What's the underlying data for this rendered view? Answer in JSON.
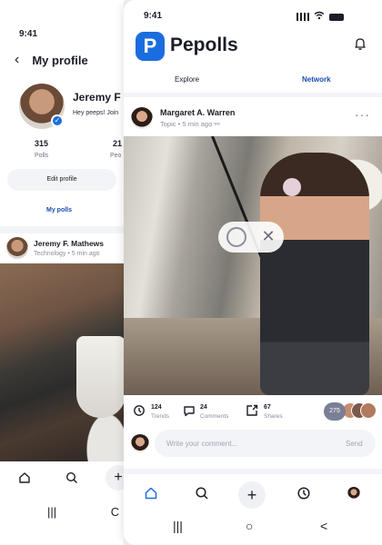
{
  "colors": {
    "accent": "#1b6ddf",
    "link": "#1b4db3",
    "surface": "#f3f4f7"
  },
  "profile_screen": {
    "time": "9:41",
    "title": "My profile",
    "user_name": "Jeremy F",
    "bio": "Hey peeps! Join",
    "stats": [
      {
        "value": "315",
        "label": "Polls"
      },
      {
        "value": "21",
        "label": "Peo"
      }
    ],
    "edit_button": "Edit profile",
    "my_polls": "My polls",
    "post": {
      "author": "Jeremy F. Mathews",
      "topic": "Technology",
      "age": "5 min ago"
    },
    "nav_icons": [
      "home-icon",
      "search-icon",
      "plus-icon"
    ],
    "system_buttons": [
      "|||",
      "C"
    ]
  },
  "feed_screen": {
    "time": "9:41",
    "brand": "Pepolls",
    "brand_mark": "P",
    "tabs": [
      {
        "label": "Explore",
        "active": false
      },
      {
        "label": "Network",
        "active": true
      }
    ],
    "post": {
      "author": "Margaret A. Warren",
      "topic": "Topic",
      "age": "5 min ago",
      "more": "···"
    },
    "vote_options": [
      "circle-option",
      "x-option"
    ],
    "actions": [
      {
        "count": "124",
        "label": "Trends",
        "icon": "trend-icon"
      },
      {
        "count": "24",
        "label": "Comments",
        "icon": "comment-icon"
      },
      {
        "count": "67",
        "label": "Shares",
        "icon": "share-icon"
      }
    ],
    "voters_count": "275",
    "comment_placeholder": "Write your comment...",
    "send_label": "Send",
    "nav_icons": [
      "home-icon",
      "search-icon",
      "plus-icon",
      "trend-icon",
      "profile-avatar"
    ],
    "system_buttons": [
      "|||",
      "○",
      "<"
    ]
  }
}
